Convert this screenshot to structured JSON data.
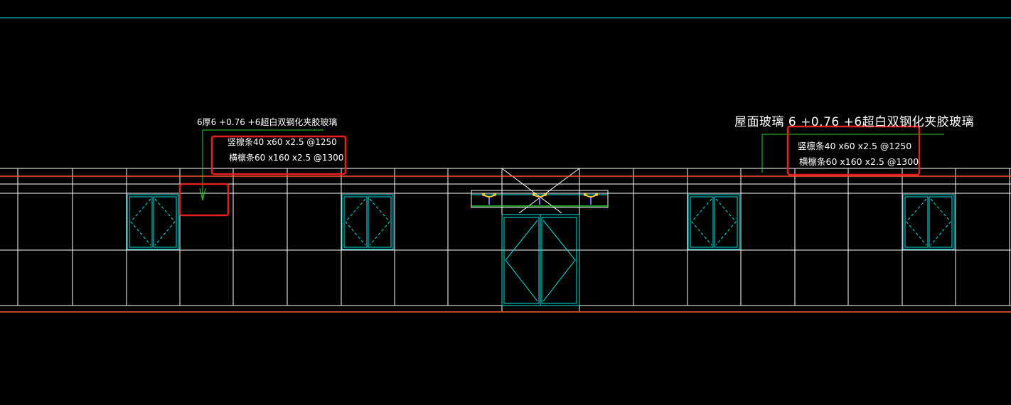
{
  "drawing": {
    "labels": {
      "left_glass_spec": "6厚6 +0.76 +6超白双钢化夹胶玻璃",
      "left_vertical_purlin": "竖檩条40 x60 x2.5 @1250",
      "left_horizontal_purlin": "横檩条60 x160 x2.5 @1300",
      "right_glass_spec": "屋面玻璃  6 +0.76 +6超白双钢化夹胶玻璃",
      "right_vertical_purlin": "竖檩条40 x60 x2.5 @1250",
      "right_horizontal_purlin": "横檩条60 x160 x2.5 @1300"
    },
    "colors": {
      "background": "#000000",
      "grid": "#ffffff",
      "frame": "#00e5e5",
      "accent_line": "#ff5a1f",
      "leader": "#33cc33",
      "highlight_box": "#e52020",
      "fitting": "#ffcc33"
    }
  }
}
